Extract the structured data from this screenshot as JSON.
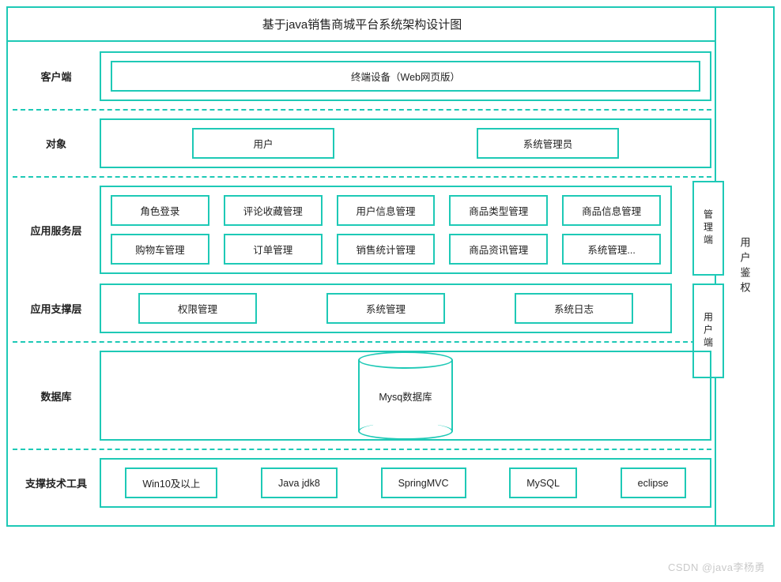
{
  "title": "基于java销售商城平台系统架构设计图",
  "watermark": "CSDN @java李杨勇",
  "right_auth": "用户鉴权",
  "side_badges": {
    "admin": "管理端",
    "user": "用户端"
  },
  "layers": {
    "client": {
      "label": "客户端",
      "items": [
        "终端设备（Web网页版）"
      ]
    },
    "object": {
      "label": "对象",
      "items": [
        "用户",
        "系统管理员"
      ]
    },
    "service": {
      "label": "应用服务层",
      "row1": [
        "角色登录",
        "评论收藏管理",
        "用户信息管理",
        "商品类型管理",
        "商品信息管理"
      ],
      "row2": [
        "购物车管理",
        "订单管理",
        "销售统计管理",
        "商品资讯管理",
        "系统管理..."
      ]
    },
    "support": {
      "label": "应用支撑层",
      "items": [
        "权限管理",
        "系统管理",
        "系统日志"
      ]
    },
    "db": {
      "label": "数据库",
      "name": "Mysq数据库"
    },
    "tech": {
      "label": "支撑技术工具",
      "items": [
        "Win10及以上",
        "Java jdk8",
        "SpringMVC",
        "MySQL",
        "eclipse"
      ]
    }
  }
}
